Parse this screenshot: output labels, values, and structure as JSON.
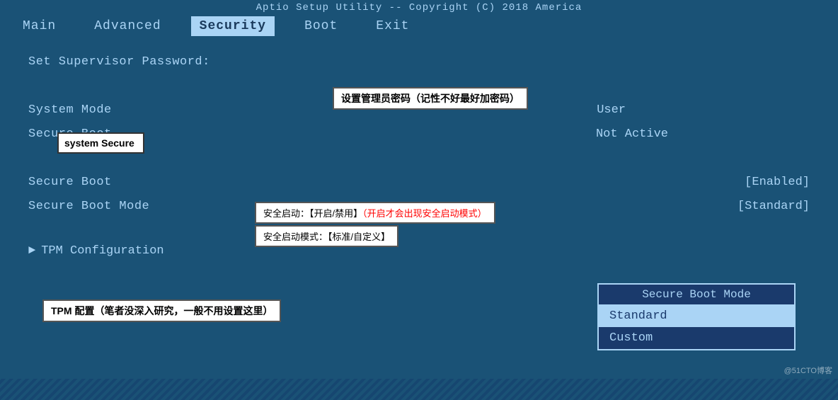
{
  "header": {
    "title": "Aptio Setup Utility -- Copyright (C) 2018 America"
  },
  "nav": {
    "items": [
      {
        "label": "Main",
        "active": false
      },
      {
        "label": "Advanced",
        "active": false
      },
      {
        "label": "Security",
        "active": true
      },
      {
        "label": "Boot",
        "active": false
      },
      {
        "label": "Exit",
        "active": false
      }
    ]
  },
  "fields": {
    "supervisor_password_label": "Set Supervisor Password:",
    "supervisor_annotation": "设置管理员密码（记性不好最好加密码）",
    "system_mode_label": "System Mode",
    "system_mode_value": "User",
    "secure_boot_label": "Secure Boot",
    "secure_boot_value": "Not Active",
    "secure_boot_enable_label": "Secure Boot",
    "secure_boot_enable_value": "[Enabled]",
    "secure_boot_mode_label": "Secure Boot Mode",
    "secure_boot_mode_value": "[Standard]",
    "tpm_label": "TPM Configuration",
    "secure_boot_annotation_label": "安全启动：【开启/禁用】",
    "secure_boot_annotation_red": "（开启才会出现安全启动模式）",
    "secure_boot_mode_annotation": "安全启动模式：【标准/自定义】",
    "tpm_annotation": "TPM 配置（笔者没深入研究，一般不用设置这里）",
    "system_secure_annotation": "system Secure"
  },
  "dropdown": {
    "title": "Secure Boot Mode",
    "options": [
      {
        "label": "Standard",
        "highlighted": true
      },
      {
        "label": "Custom",
        "highlighted": false
      }
    ]
  },
  "watermark": "@51CTO博客"
}
